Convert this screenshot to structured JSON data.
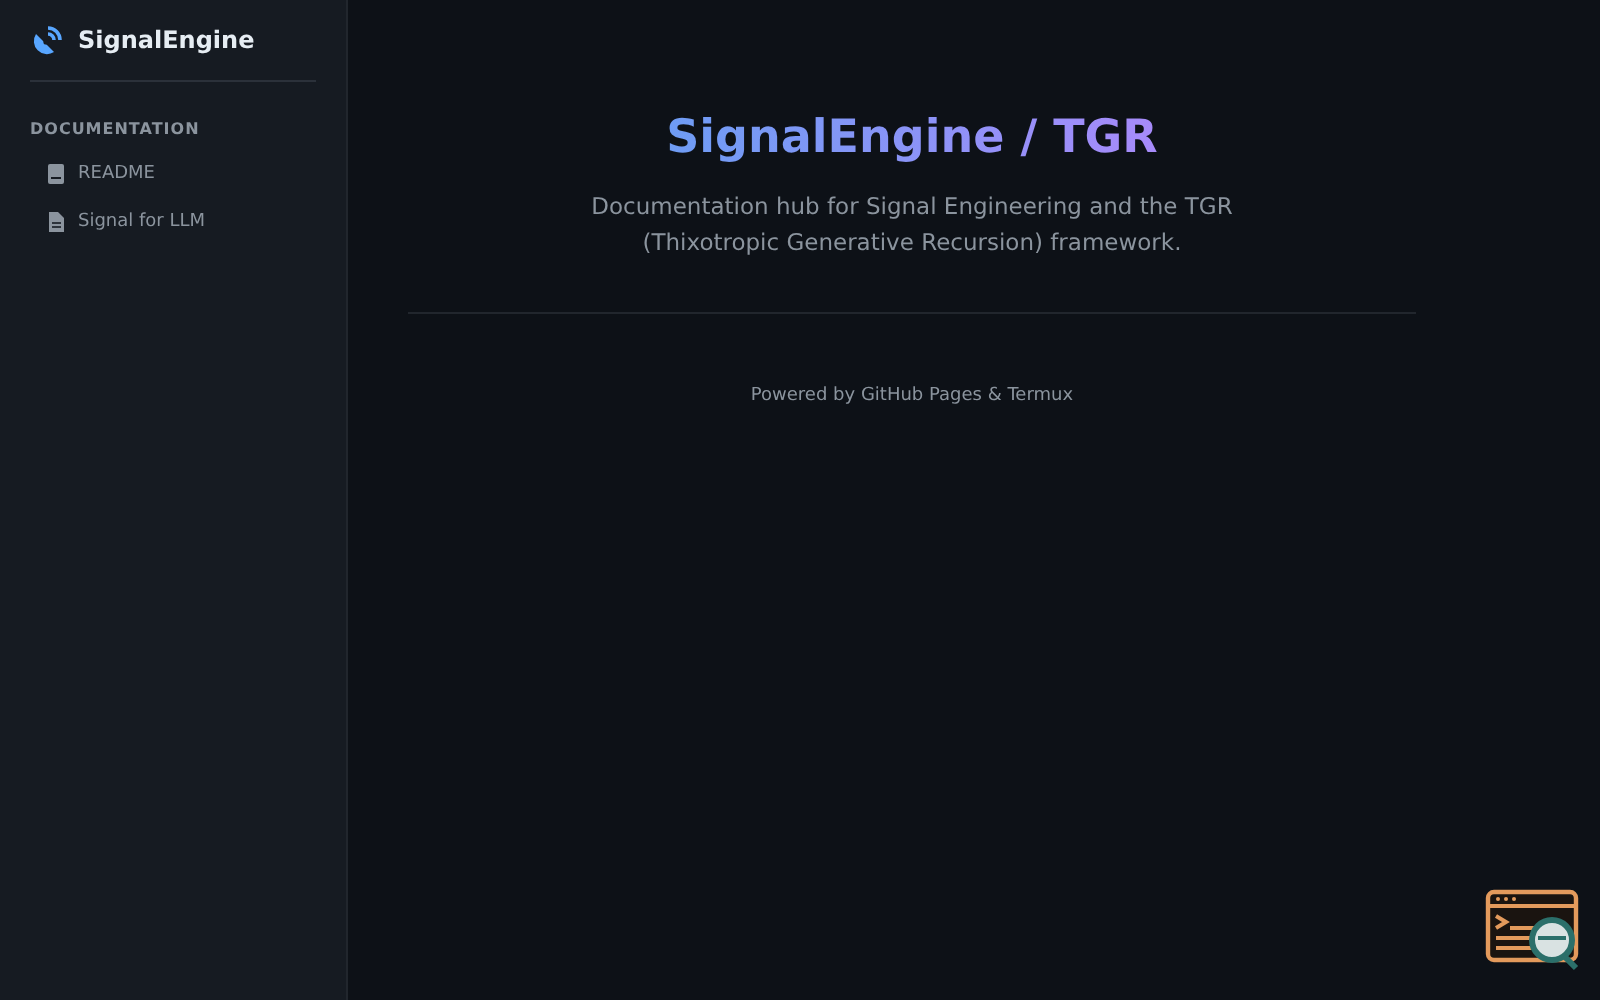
{
  "brand": {
    "name": "SignalEngine"
  },
  "sidebar": {
    "section": "DOCUMENTATION",
    "items": [
      {
        "label": "README",
        "kind": "book"
      },
      {
        "label": "Signal for LLM",
        "kind": "file"
      }
    ]
  },
  "hero": {
    "title": "SignalEngine / TGR",
    "description": "Documentation hub for Signal Engineering and the TGR (Thixotropic Generative Recursion) framework."
  },
  "footer": "Powered by GitHub Pages & Termux"
}
